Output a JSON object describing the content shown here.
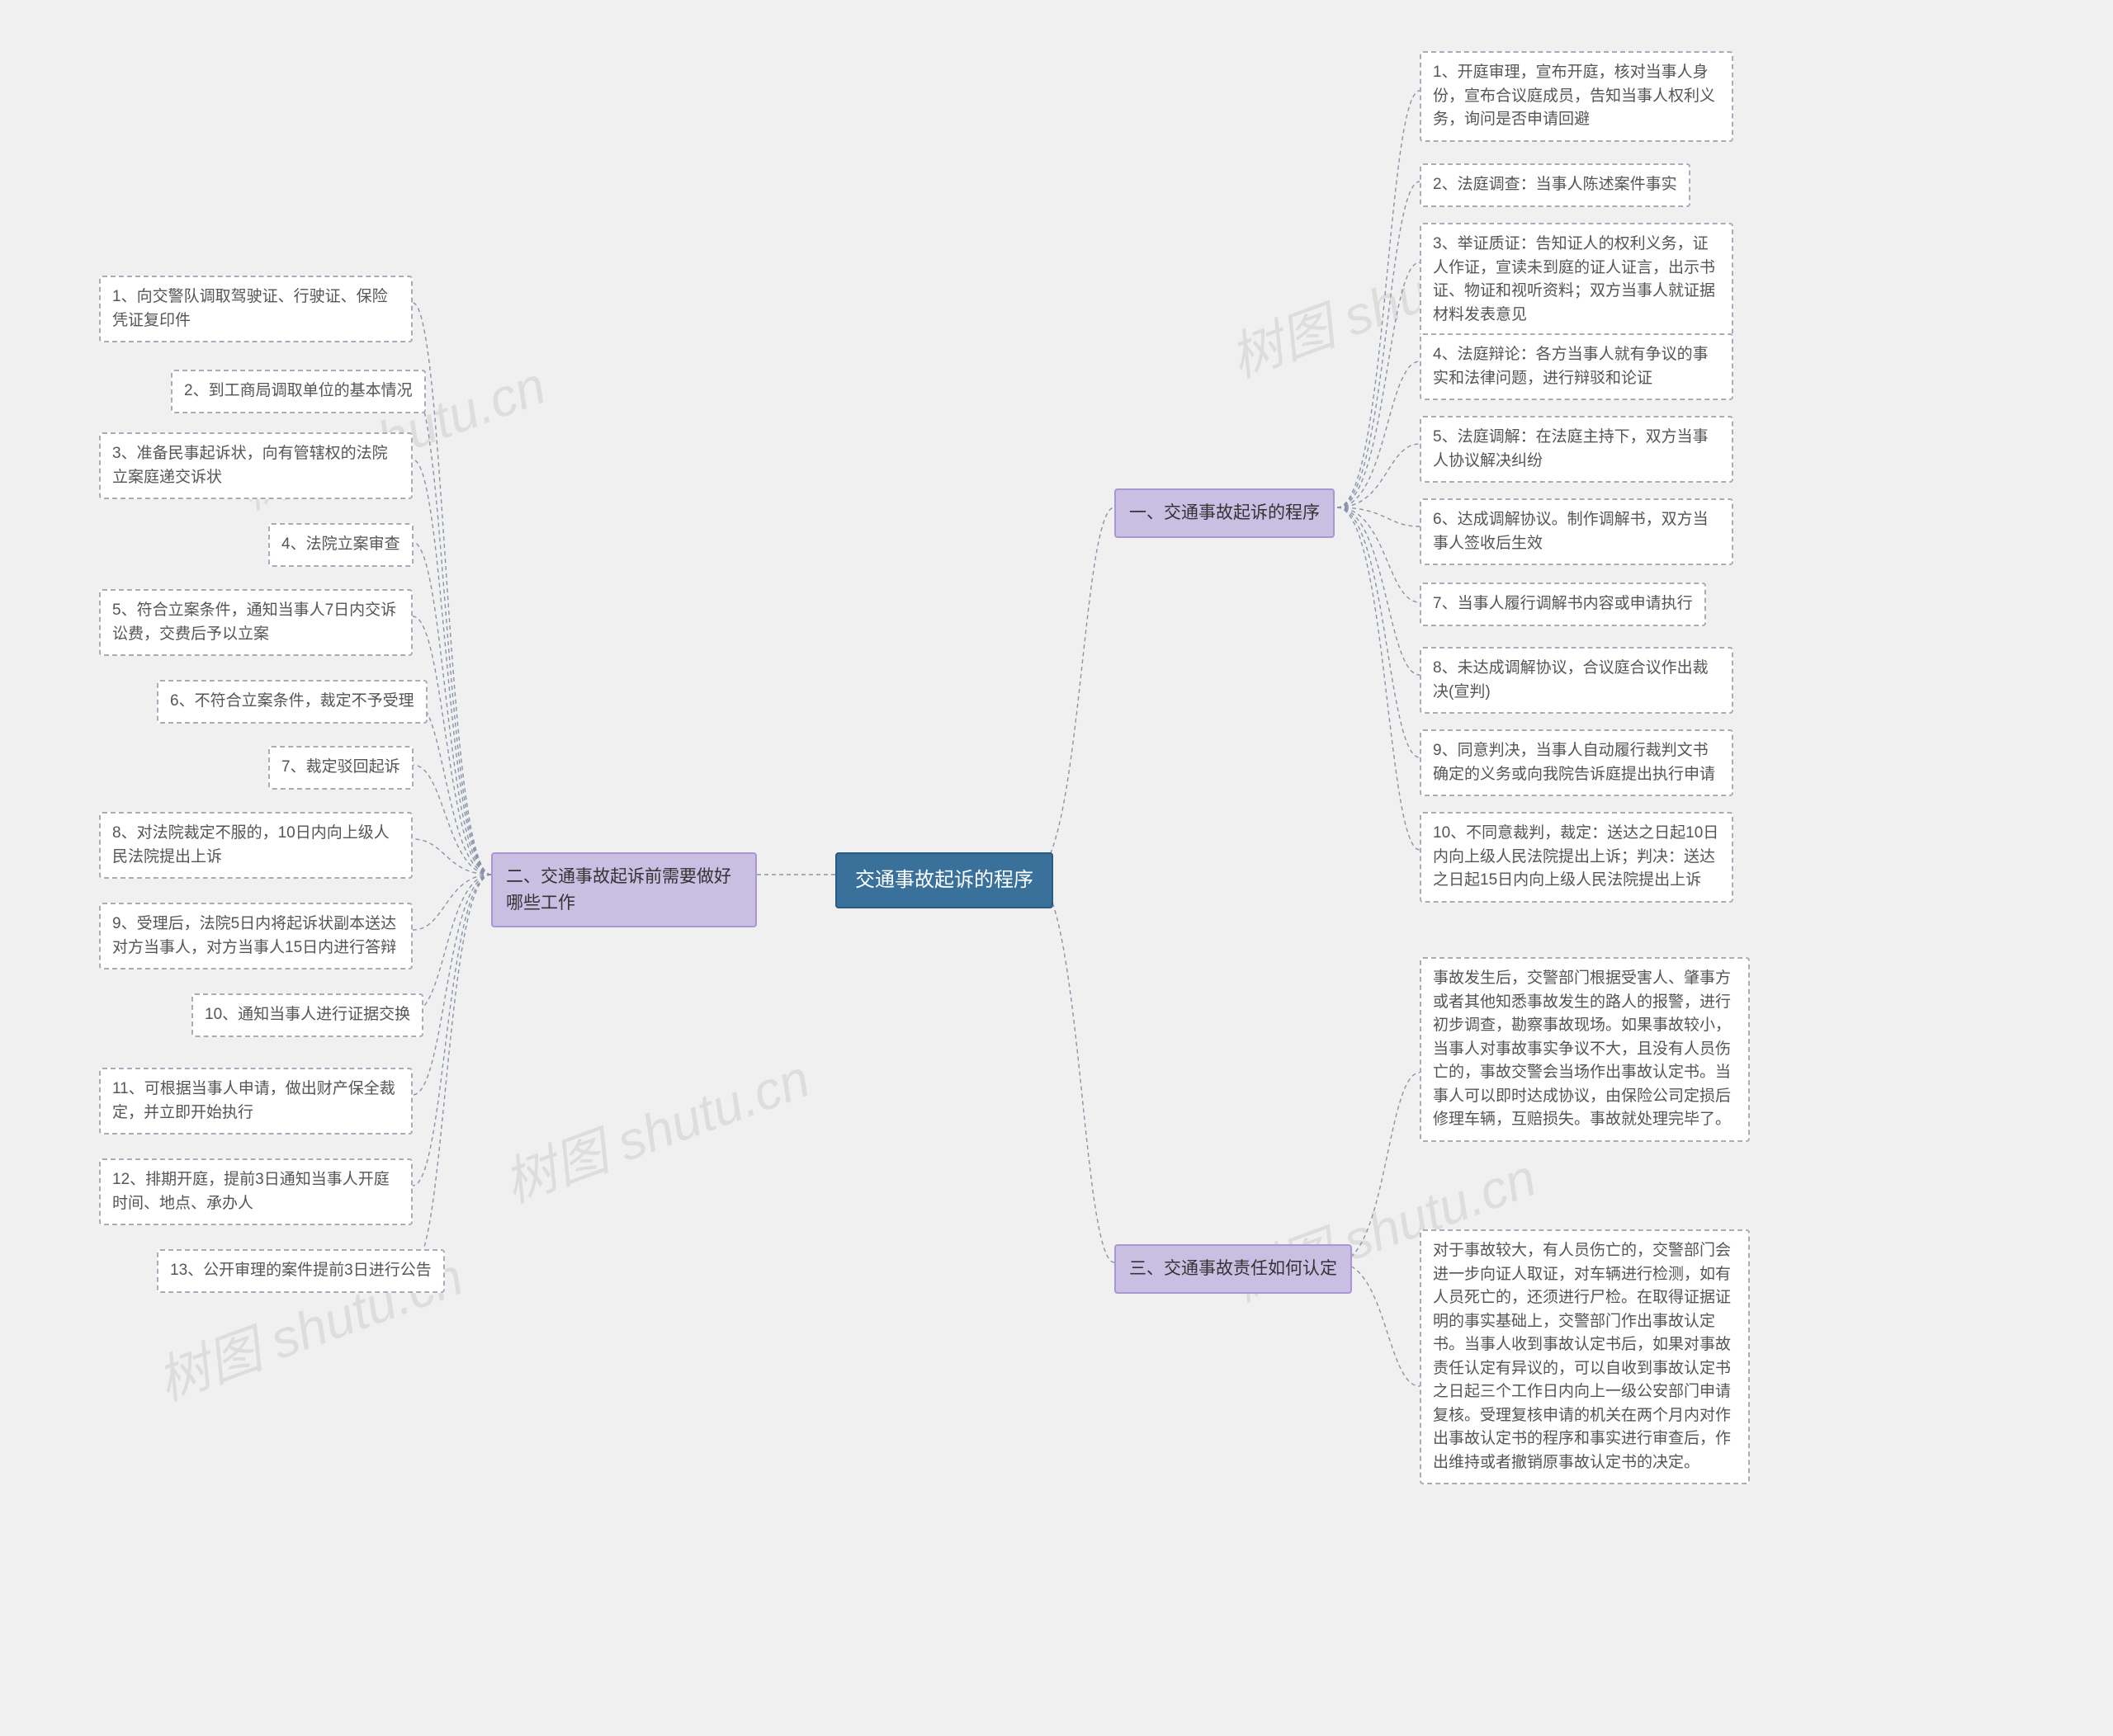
{
  "root": {
    "title": "交通事故起诉的程序"
  },
  "branches": {
    "b1": {
      "title": "一、交通事故起诉的程序",
      "items": [
        "1、开庭审理，宣布开庭，核对当事人身份，宣布合议庭成员，告知当事人权利义务，询问是否申请回避",
        "2、法庭调查：当事人陈述案件事实",
        "3、举证质证：告知证人的权利义务，证人作证，宣读未到庭的证人证言，出示书证、物证和视听资料；双方当事人就证据材料发表意见",
        "4、法庭辩论：各方当事人就有争议的事实和法律问题，进行辩驳和论证",
        "5、法庭调解：在法庭主持下，双方当事人协议解决纠纷",
        "6、达成调解协议。制作调解书，双方当事人签收后生效",
        "7、当事人履行调解书内容或申请执行",
        "8、未达成调解协议，合议庭合议作出裁决(宣判)",
        "9、同意判决，当事人自动履行裁判文书确定的义务或向我院告诉庭提出执行申请",
        "10、不同意裁判，裁定：送达之日起10日内向上级人民法院提出上诉；判决：送达之日起15日内向上级人民法院提出上诉"
      ]
    },
    "b2": {
      "title": "二、交通事故起诉前需要做好哪些工作",
      "items": [
        "1、向交警队调取驾驶证、行驶证、保险凭证复印件",
        "2、到工商局调取单位的基本情况",
        "3、准备民事起诉状，向有管辖权的法院立案庭递交诉状",
        "4、法院立案审查",
        "5、符合立案条件，通知当事人7日内交诉讼费，交费后予以立案",
        "6、不符合立案条件，裁定不予受理",
        "7、裁定驳回起诉",
        "8、对法院裁定不服的，10日内向上级人民法院提出上诉",
        "9、受理后，法院5日内将起诉状副本送达对方当事人，对方当事人15日内进行答辩",
        "10、通知当事人进行证据交换",
        "11、可根据当事人申请，做出财产保全裁定，并立即开始执行",
        "12、排期开庭，提前3日通知当事人开庭时间、地点、承办人",
        "13、公开审理的案件提前3日进行公告"
      ]
    },
    "b3": {
      "title": "三、交通事故责任如何认定",
      "items": [
        "事故发生后，交警部门根据受害人、肇事方或者其他知悉事故发生的路人的报警，进行初步调查，勘察事故现场。如果事故较小，当事人对事故事实争议不大，且没有人员伤亡的，事故交警会当场作出事故认定书。当事人可以即时达成协议，由保险公司定损后修理车辆，互赔损失。事故就处理完毕了。",
        "对于事故较大，有人员伤亡的，交警部门会进一步向证人取证，对车辆进行检测，如有人员死亡的，还须进行尸检。在取得证据证明的事实基础上，交警部门作出事故认定书。当事人收到事故认定书后，如果对事故责任认定有异议的，可以自收到事故认定书之日起三个工作日内向上一级公安部门申请复核。受理复核申请的机关在两个月内对作出事故认定书的程序和事实进行审查后，作出维持或者撤销原事故认定书的决定。"
      ]
    }
  },
  "watermarks": [
    "树图 shutu.cn",
    "树图 shutu.cn",
    "树图 shutu.cn",
    "树图 shutu.cn",
    "树图 shutu.cn"
  ]
}
